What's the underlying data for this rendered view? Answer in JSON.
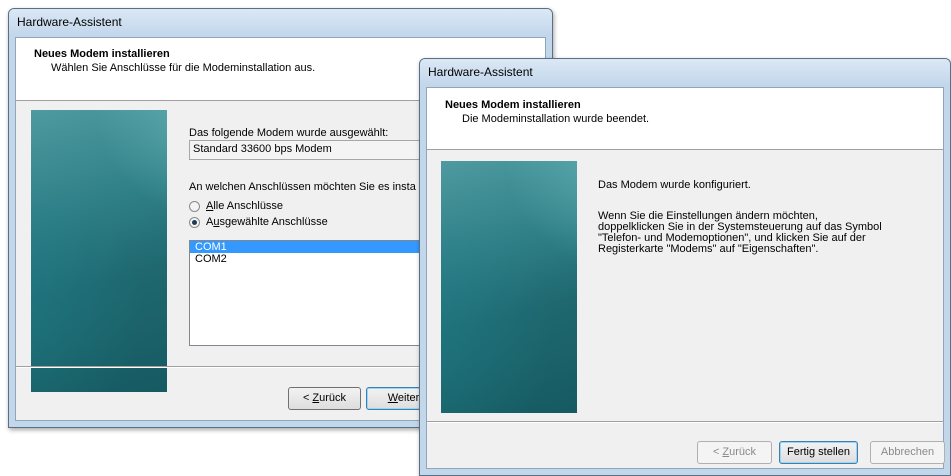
{
  "dialog_back": {
    "title": "Hardware-Assistent",
    "header_title": "Neues Modem installieren",
    "header_subtitle": "Wählen Sie Anschlüsse für die Modeminstallation aus.",
    "modem_label": "Das folgende Modem wurde ausgewählt:",
    "modem_value": "Standard 33600 bps Modem",
    "ports_question": "An welchen Anschlüssen möchten Sie es insta",
    "radio_all": {
      "prefix": "",
      "accel": "A",
      "rest": "lle Anschlüsse",
      "checked": false
    },
    "radio_selected": {
      "prefix": "A",
      "accel": "u",
      "rest": "sgewählte Anschlüsse",
      "checked": true
    },
    "ports": [
      {
        "label": "COM1",
        "selected": true
      },
      {
        "label": "COM2",
        "selected": false
      }
    ],
    "btn_back": {
      "prefix": "< ",
      "accel": "Z",
      "rest": "urück"
    },
    "btn_next": {
      "prefix": "",
      "accel": "W",
      "rest": "eiter"
    }
  },
  "dialog_front": {
    "title": "Hardware-Assistent",
    "header_title": "Neues Modem installieren",
    "header_subtitle": "Die Modeminstallation wurde beendet.",
    "message_1": "Das Modem wurde konfiguriert.",
    "message_2_lines": [
      "Wenn Sie die Einstellungen ändern möchten,",
      "doppelklicken Sie in der Systemsteuerung auf das Symbol",
      "\"Telefon- und Modemoptionen\", und klicken Sie auf der",
      "Registerkarte \"Modems\" auf \"Eigenschaften\"."
    ],
    "btn_back": {
      "prefix": "< ",
      "accel": "Z",
      "rest": "urück"
    },
    "btn_finish": "Fertig stellen",
    "btn_cancel": "Abbrechen"
  },
  "colors": {
    "selection": "#3399ff",
    "titlebar": "#c2d6eb",
    "client": "#f0f0f0",
    "side_image": "#1f6870"
  }
}
